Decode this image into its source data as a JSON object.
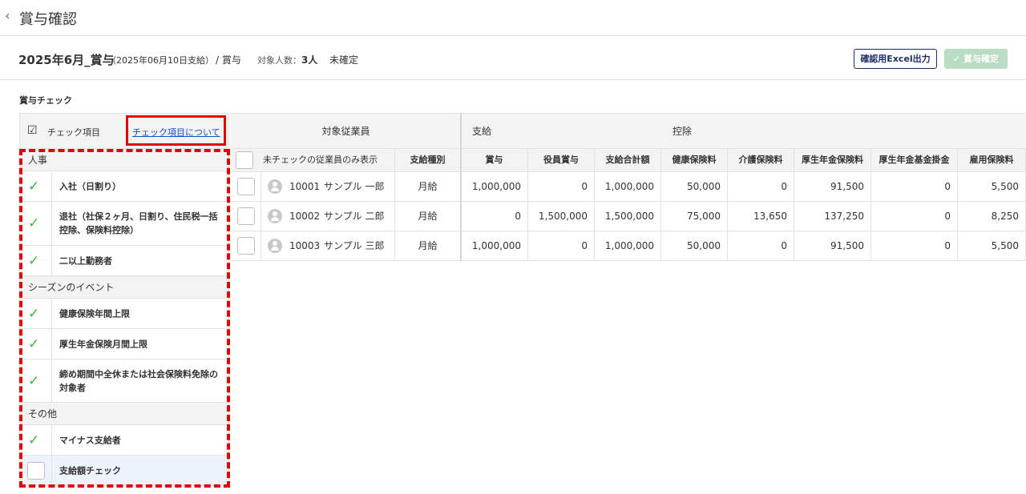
{
  "header": {
    "back_icon": "chevron-left-icon",
    "title": "賞与確認"
  },
  "bonus": {
    "name": "2025年6月_賞与",
    "pay_date": "（2025年06月10日支給）",
    "kind": "/ 賞与",
    "count_label": "対象人数：",
    "count_value": "3人",
    "status": "未確定",
    "excel_button": "確認用Excel出力",
    "confirm_button": "✓ 賞与確定"
  },
  "section_title": "賞与チェック",
  "check_panel": {
    "header_label": "チェック項目",
    "about_link": "チェック項目について",
    "categories": [
      {
        "name": "人事",
        "items": [
          {
            "label": "入社（日割り）",
            "checked": true
          },
          {
            "label": "退社（社保２ヶ月、日割り、住民税一括控除、保険料控除）",
            "checked": true
          },
          {
            "label": "二以上勤務者",
            "checked": true
          }
        ]
      },
      {
        "name": "シーズンのイベント",
        "items": [
          {
            "label": "健康保険年間上限",
            "checked": true
          },
          {
            "label": "厚生年金保険月間上限",
            "checked": true
          },
          {
            "label": "締め期間中全休または社会保険料免除の対象者",
            "checked": true
          }
        ]
      },
      {
        "name": "その他",
        "items": [
          {
            "label": "マイナス支給者",
            "checked": true
          },
          {
            "label": "支給額チェック",
            "checked": false
          }
        ]
      }
    ]
  },
  "table": {
    "group_headers": {
      "employee": "対象従業員",
      "payment": "支給",
      "deduction": "控除"
    },
    "filter_label": "未チェックの従業員のみ表示",
    "columns": {
      "pay_type": "支給種別",
      "bonus": "賞与",
      "officer_bonus": "役員賞与",
      "total": "支給合計額",
      "health": "健康保険料",
      "care": "介護保険料",
      "pension": "厚生年金保険料",
      "pension_fund": "厚生年金基金掛金",
      "employment": "雇用保険料"
    },
    "rows": [
      {
        "id": "10001",
        "name": "サンプル 一郎",
        "pay_type": "月給",
        "bonus": "1,000,000",
        "officer_bonus": "0",
        "total": "1,000,000",
        "health": "50,000",
        "care": "0",
        "pension": "91,500",
        "pension_fund": "0",
        "employment": "5,500"
      },
      {
        "id": "10002",
        "name": "サンプル 二郎",
        "pay_type": "月給",
        "bonus": "0",
        "officer_bonus": "1,500,000",
        "total": "1,500,000",
        "health": "75,000",
        "care": "13,650",
        "pension": "137,250",
        "pension_fund": "0",
        "employment": "8,250"
      },
      {
        "id": "10003",
        "name": "サンプル 三郎",
        "pay_type": "月給",
        "bonus": "1,000,000",
        "officer_bonus": "0",
        "total": "1,000,000",
        "health": "50,000",
        "care": "0",
        "pension": "91,500",
        "pension_fund": "0",
        "employment": "5,500"
      }
    ]
  },
  "colors": {
    "accent_green": "#3bb34a",
    "highlight_red": "#e10000",
    "link_blue": "#1a4fc4",
    "navy": "#1f2f6b"
  }
}
